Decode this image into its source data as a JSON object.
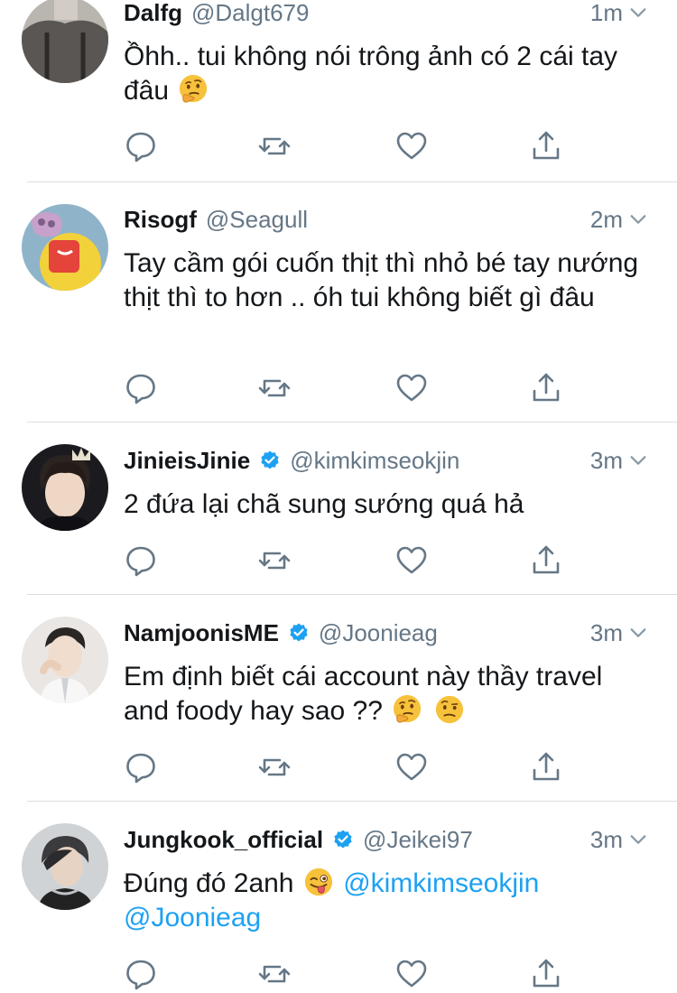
{
  "tweets": [
    {
      "name": "Dalfg",
      "handle": "@Dalgt679",
      "time": "1m",
      "verified": false,
      "text": "Ồhh.. tui không nói trông ảnh có 2 cái tay đâu",
      "emojis": [
        "thinking-face"
      ]
    },
    {
      "name": "Risogf",
      "handle": "@Seagull",
      "time": "2m",
      "verified": false,
      "text": "Tay cầm gói cuốn thịt thì nhỏ bé tay nướng thịt thì to hơn .. óh tui không biết gì đâu",
      "emojis": []
    },
    {
      "name": "JinieisJinie",
      "handle": "@kimkimseokjin",
      "time": "3m",
      "verified": true,
      "text": "2 đứa lại chã sung sướng quá hả",
      "emojis": []
    },
    {
      "name": "NamjoonisME",
      "handle": "@Joonieag",
      "time": "3m",
      "verified": true,
      "text": "Em định biết cái account này thầy travel and foody hay sao ??",
      "emojis": [
        "thinking-face",
        "face-with-raised-eyebrow"
      ]
    },
    {
      "name": "Jungkook_official",
      "handle": "@Jeikei97",
      "time": "3m",
      "verified": true,
      "text": "Đúng đó 2anh",
      "emojis": [
        "winking-face-with-tongue"
      ],
      "mentions": [
        "@kimkimseokjin",
        "@Joonieag"
      ]
    }
  ],
  "icons": {
    "action_color": "#657786",
    "verified_color": "#1da1f2",
    "mention_color": "#1da1f2"
  }
}
